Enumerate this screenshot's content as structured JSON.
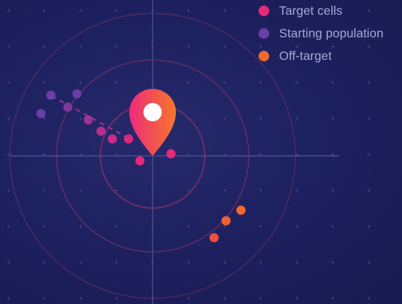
{
  "legend": {
    "items": [
      {
        "label": "Target cells",
        "color": "#e8267a"
      },
      {
        "label": "Starting population",
        "color": "#6b3fa5"
      },
      {
        "label": "Off-target",
        "color": "#f06a2e"
      }
    ]
  },
  "marker": {
    "icon": "map-pin-icon",
    "gradient": [
      "#ee2a7b",
      "#f5772a"
    ]
  },
  "colors": {
    "background": "#1e2160",
    "rings": "#6e2f66",
    "crosshair": "#4a4f95",
    "grid_dots": "#3a3f85",
    "path": "#a8328a"
  }
}
